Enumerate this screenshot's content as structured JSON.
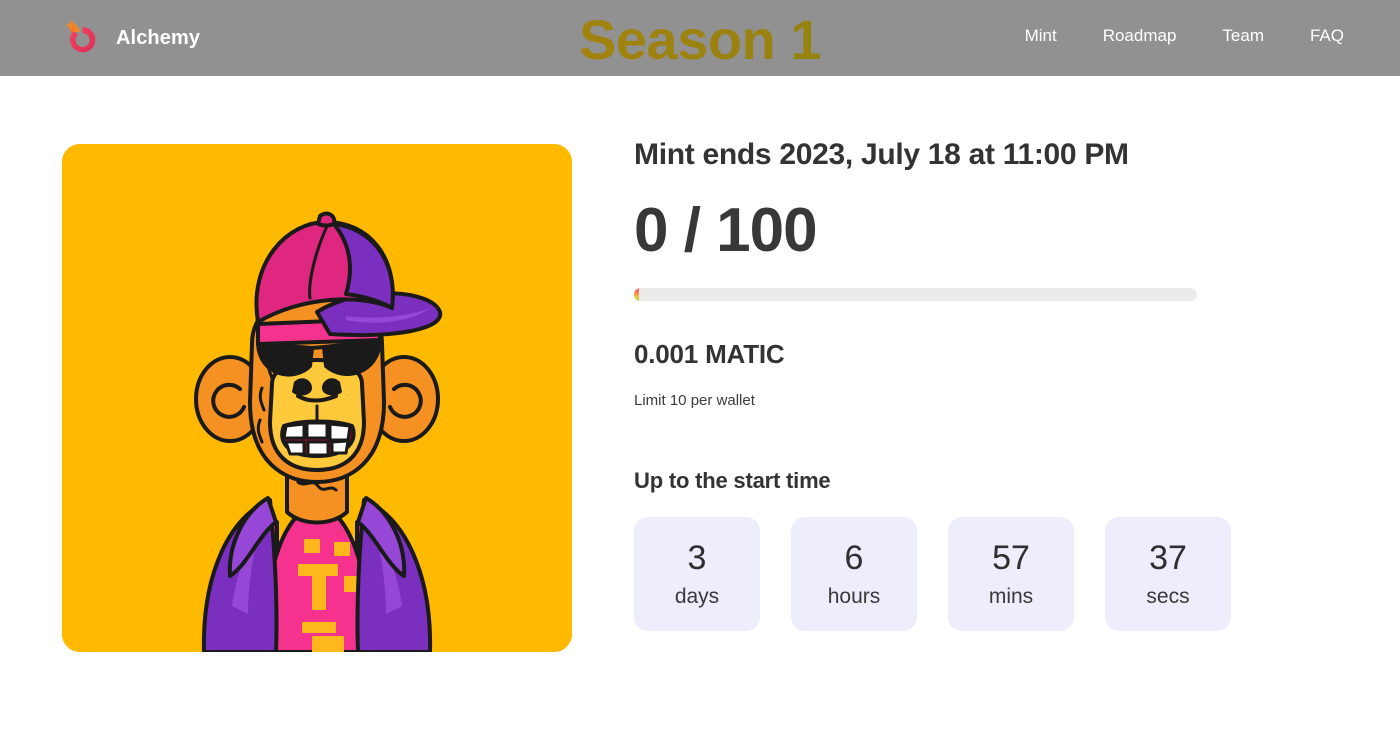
{
  "header": {
    "brand_name": "Alchemy",
    "logo_icon": "alchemy-flame-logo",
    "season_title": "Season 1",
    "nav": [
      {
        "label": "Mint"
      },
      {
        "label": "Roadmap"
      },
      {
        "label": "Team"
      },
      {
        "label": "FAQ"
      }
    ],
    "background_color": "#919191",
    "title_gradient_from": "#c2780f",
    "title_gradient_to": "#8a8a10"
  },
  "nft": {
    "alt": "bored-ape-nft-artwork",
    "background_color": "#ffba00",
    "traits": {
      "fur": "orange",
      "hat": "pink-purple-cap",
      "eyes": "black-sunglasses",
      "mouth": "grin-teeth",
      "clothes": "purple-vest-pink-shirt"
    }
  },
  "mint": {
    "deadline_text": "Mint ends 2023, July 18 at 11:00 PM",
    "minted_count": "0 / 100",
    "progress_percent": 0,
    "progress_track_color": "#ebebeb",
    "price": "0.001 MATIC",
    "limit_text": "Limit 10 per wallet"
  },
  "countdown": {
    "heading": "Up to the start time",
    "box_color": "#ededfb",
    "units": [
      {
        "value": "3",
        "label": "days"
      },
      {
        "value": "6",
        "label": "hours"
      },
      {
        "value": "57",
        "label": "mins"
      },
      {
        "value": "37",
        "label": "secs"
      }
    ]
  }
}
